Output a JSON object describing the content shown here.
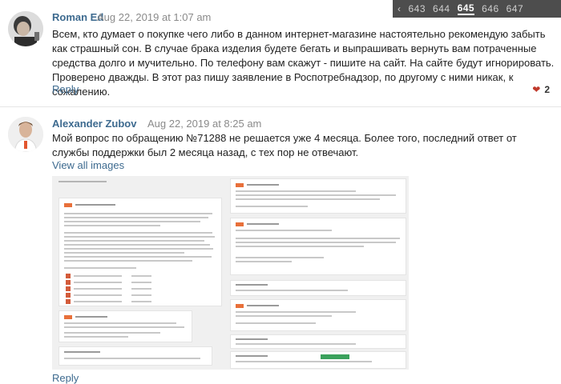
{
  "pager": {
    "pages": [
      "643",
      "644",
      "645",
      "646",
      "647"
    ],
    "current": "645",
    "prev_icon": "chevron-left-icon"
  },
  "comments": [
    {
      "author": "Roman Ed",
      "date": "Aug 22, 2019 at 1:07 am",
      "text": "Всем, кто думает о покупке чего либо в данном интернет-магазине настоятельно рекомендую забыть как страшный сон. В случае брака изделия будете бегать и выпрашивать вернуть вам потраченные средства долго и мучительно. По телефону вам скажут - пишите на сайт. На сайте будут игнорировать. Проверено дважды. В этот раз пишу заявление в Роспотребнадзор, по другому с ними никак, к сожалению.",
      "reply": "Reply",
      "likes": "2",
      "like_icon": "heart-icon"
    },
    {
      "author": "Alexander Zubov",
      "date": "Aug 22, 2019 at 8:25 am",
      "text": "Мой вопрос по обращению №71288 не решается уже 4 месяца. Более того, последний ответ от службы поддержки был 2 месяца назад, с тех пор не отвечают.",
      "view_all": "View all images",
      "reply": "Reply"
    }
  ],
  "colors": {
    "link": "#3d6a8f",
    "pager_bg": "#4d4d4d",
    "heart": "#c0392b",
    "brand_tag": "#e8703a"
  }
}
